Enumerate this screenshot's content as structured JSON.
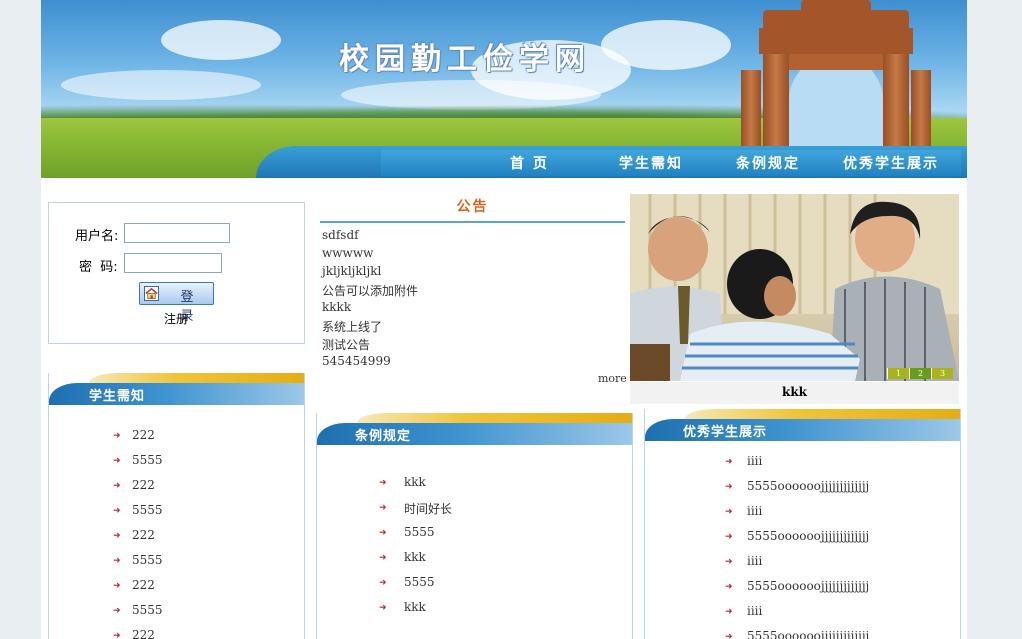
{
  "header": {
    "site_title": "校园勤工俭学网",
    "nav": [
      "首 页",
      "学生需知",
      "条例规定",
      "优秀学生展示"
    ]
  },
  "login": {
    "username_label": "用户名:",
    "password_label": "密  码:",
    "username_value": "",
    "password_value": "",
    "login_button": "登 录",
    "register_link": "注册"
  },
  "notice": {
    "title": "公告",
    "items": [
      "sdfsdf",
      "wwwww",
      "jkljkljkljkl",
      "公告可以添加附件",
      "kkkk",
      "系统上线了",
      "测试公告",
      "545454999"
    ],
    "more": "more"
  },
  "photo": {
    "caption": "kkk",
    "pager": [
      "1",
      "2",
      "3"
    ]
  },
  "student_notice": {
    "title": "学生需知",
    "items": [
      "222",
      "5555",
      "222",
      "5555",
      "222",
      "5555",
      "222",
      "5555",
      "222"
    ]
  },
  "regulations": {
    "title": "条例规定",
    "items": [
      "kkk",
      "时间好长",
      "5555",
      "kkk",
      "5555",
      "kkk"
    ]
  },
  "excellent_students": {
    "title": "优秀学生展示",
    "items": [
      "iiii",
      "5555oooooojjjjjjjjjjjjj",
      "iiii",
      "5555oooooojjjjjjjjjjjjj",
      "iiii",
      "5555oooooojjjjjjjjjjjjj",
      "iiii",
      "5555oooooojjjjjjjjjjjjj"
    ]
  },
  "colors": {
    "nav_blue": "#1d77b5",
    "notice_title": "#d2691e",
    "bullet_red": "#c3262b"
  }
}
